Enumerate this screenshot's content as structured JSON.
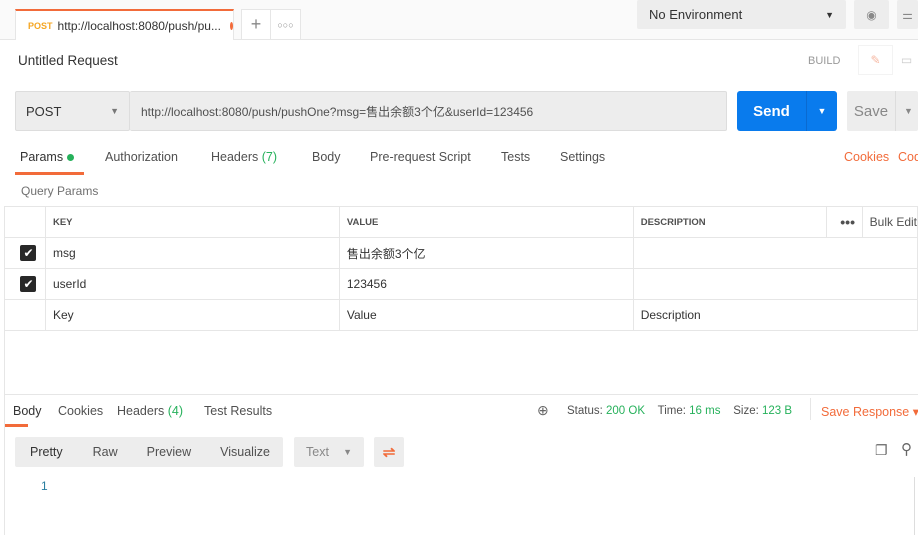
{
  "tab": {
    "method": "POST",
    "title": "http://localhost:8080/push/pu..."
  },
  "environment": "No Environment",
  "request": {
    "title": "Untitled Request",
    "build": "BUILD",
    "method": "POST",
    "url": "http://localhost:8080/push/pushOne?msg=售出余额3个亿&userId=123456",
    "send": "Send",
    "save": "Save"
  },
  "req_tabs": {
    "params": "Params",
    "authorization": "Authorization",
    "headers": "Headers",
    "headers_count": "(7)",
    "body": "Body",
    "prerequest": "Pre-request Script",
    "tests": "Tests",
    "settings": "Settings",
    "cookies": "Cookies",
    "code": "Code"
  },
  "query_params": "Query Params",
  "columns": {
    "key": "KEY",
    "value": "VALUE",
    "description": "DESCRIPTION",
    "bulk": "Bulk Edit"
  },
  "rows": [
    {
      "key": "msg",
      "value": "售出余额3个亿",
      "checked": true
    },
    {
      "key": "userId",
      "value": "123456",
      "checked": true
    }
  ],
  "placeholders": {
    "key": "Key",
    "value": "Value",
    "description": "Description"
  },
  "resp_tabs": {
    "body": "Body",
    "cookies": "Cookies",
    "headers": "Headers",
    "headers_count": "(4)",
    "tests": "Test Results"
  },
  "status": {
    "status_label": "Status:",
    "status": "200 OK",
    "time_label": "Time:",
    "time": "16 ms",
    "size_label": "Size:",
    "size": "123 B",
    "save": "Save Response"
  },
  "view": {
    "pretty": "Pretty",
    "raw": "Raw",
    "preview": "Preview",
    "visualize": "Visualize",
    "format": "Text"
  },
  "body_line": "1"
}
